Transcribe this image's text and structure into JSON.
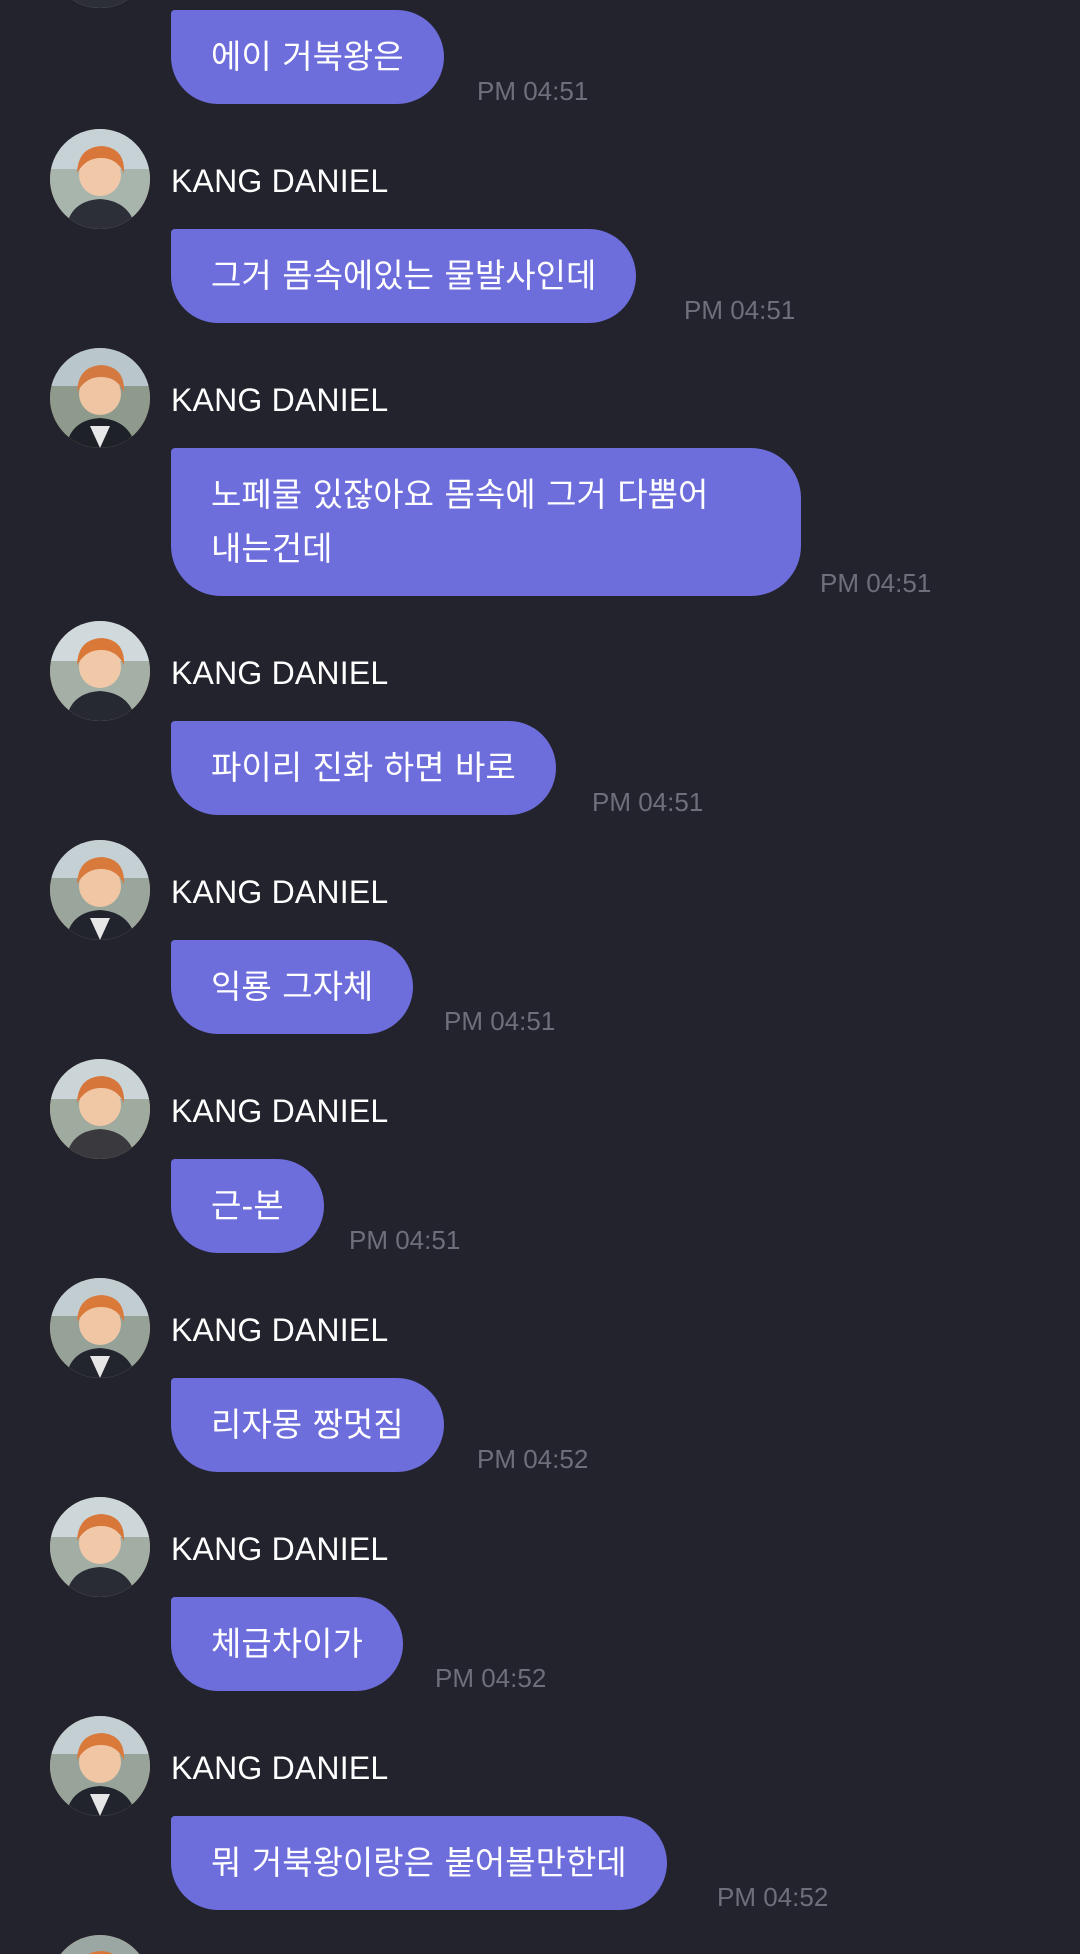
{
  "chat": {
    "background": "#22232c",
    "bubble_color": "#6e6ddc",
    "messages": [
      {
        "sender": "",
        "lines": [
          "에이 거북왕은"
        ],
        "time": "PM 04:51"
      },
      {
        "sender": "KANG DANIEL",
        "lines": [
          "그거 몸속에있는 물발사인데"
        ],
        "time": "PM 04:51"
      },
      {
        "sender": "KANG DANIEL",
        "lines": [
          "노페물 있잖아요 몸속에 그거 다뿜어",
          "내는건데"
        ],
        "time": "PM 04:51"
      },
      {
        "sender": "KANG DANIEL",
        "lines": [
          "파이리 진화 하면 바로"
        ],
        "time": "PM 04:51"
      },
      {
        "sender": "KANG DANIEL",
        "lines": [
          "익룡 그자체"
        ],
        "time": "PM 04:51"
      },
      {
        "sender": "KANG DANIEL",
        "lines": [
          "근-본"
        ],
        "time": "PM 04:51"
      },
      {
        "sender": "KANG DANIEL",
        "lines": [
          "리자몽 짱멋짐"
        ],
        "time": "PM 04:52"
      },
      {
        "sender": "KANG DANIEL",
        "lines": [
          "체급차이가"
        ],
        "time": "PM 04:52"
      },
      {
        "sender": "KANG DANIEL",
        "lines": [
          "뭐 거북왕이랑은 붙어볼만한데"
        ],
        "time": "PM 04:52"
      }
    ]
  }
}
